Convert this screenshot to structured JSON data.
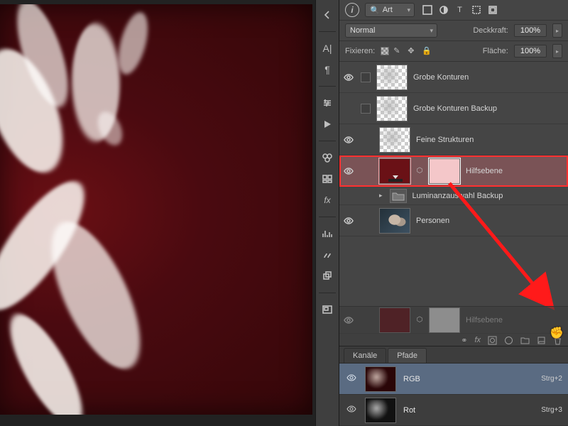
{
  "panel": {
    "search_label": "Art",
    "blend_mode": "Normal",
    "opacity_label": "Deckkraft:",
    "opacity_value": "100%",
    "lock_label": "Fixieren:",
    "fill_label": "Fläche:",
    "fill_value": "100%"
  },
  "layers": [
    {
      "name": "Grobe Konturen",
      "visible": true,
      "checkbox": true,
      "thumb": "trans"
    },
    {
      "name": "Grobe Konturen Backup",
      "visible": false,
      "checkbox": true,
      "thumb": "trans"
    },
    {
      "name": "Feine Strukturen",
      "visible": true,
      "checkbox": false,
      "thumb": "trans"
    },
    {
      "name": "Hilfsebene",
      "visible": true,
      "checkbox": false,
      "selected": true,
      "thumb": "redfill",
      "mask": true
    },
    {
      "name": "Luminanzauswahl Backup",
      "visible": false,
      "small": true,
      "folder": true
    },
    {
      "name": "Personen",
      "visible": true,
      "thumb": "photo"
    }
  ],
  "ghost_layer": {
    "name": "Hilfsebene"
  },
  "channels": {
    "tabs": {
      "channels": "Kanäle",
      "paths": "Pfade"
    },
    "rows": [
      {
        "name": "RGB",
        "shortcut": "Strg+2",
        "selected": true,
        "thumb": "rgb"
      },
      {
        "name": "Rot",
        "shortcut": "Strg+3",
        "selected": false,
        "thumb": "r"
      }
    ]
  }
}
